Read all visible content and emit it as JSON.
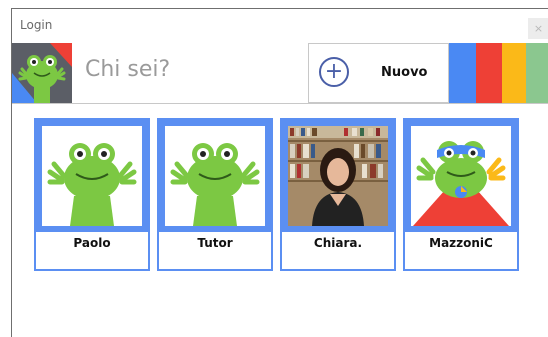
{
  "window": {
    "title": "Login",
    "close_glyph": "×"
  },
  "header": {
    "prompt": "Chi sei?",
    "new_user_label": "Nuovo",
    "new_user_icon": "plus-icon"
  },
  "colors": {
    "blue": "#4a89f3",
    "red": "#ee4036",
    "yellow": "#fbb918",
    "green": "#8bc78f",
    "card_border": "#5b8ff2",
    "frog": "#7cc843"
  },
  "users": [
    {
      "name": "Paolo",
      "avatar": "frog-avatar"
    },
    {
      "name": "Tutor",
      "avatar": "frog-avatar"
    },
    {
      "name": "Chiara.",
      "avatar": "photo-avatar"
    },
    {
      "name": "MazzoniC",
      "avatar": "superhero-frog-avatar"
    }
  ]
}
